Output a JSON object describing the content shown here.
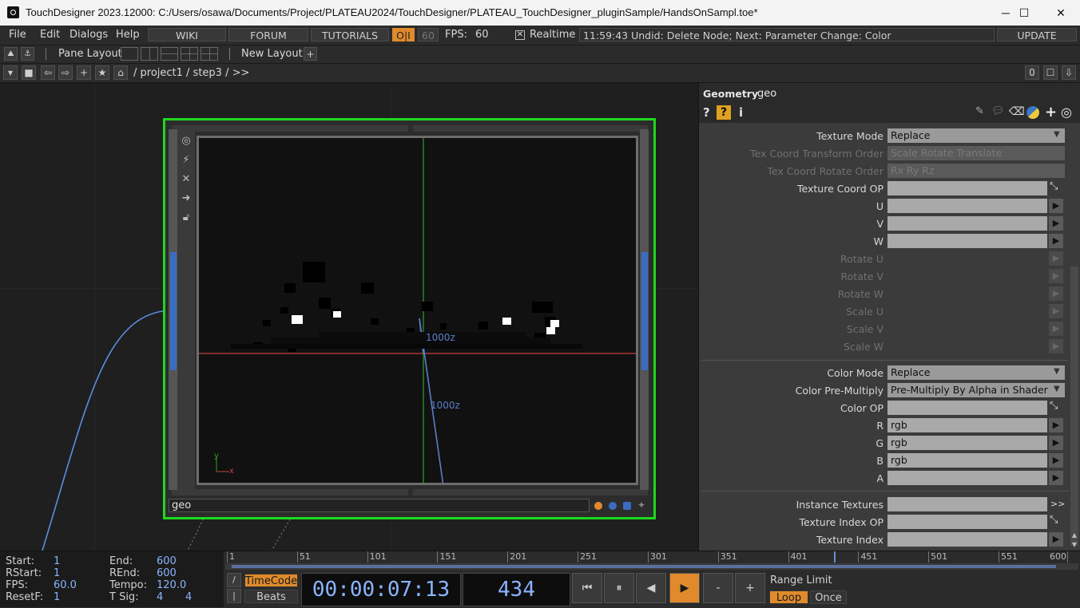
{
  "titlebar": {
    "title": "TouchDesigner 2023.12000: C:/Users/osawa/Documents/Project/PLATEAU2024/TouchDesigner/PLATEAU_TouchDesigner_pluginSample/HandsOnSampl.toe*",
    "minimize": "─",
    "maximize": "☐",
    "close": "✕"
  },
  "menu": {
    "file": "File",
    "edit": "Edit",
    "dialogs": "Dialogs",
    "help": "Help",
    "wiki": "WIKI",
    "forum": "FORUM",
    "tutorials": "TUTORIALS",
    "oi": "O|I",
    "fps_box": "60",
    "fps_label": "FPS:",
    "fps_value": "60",
    "realtime": "Realtime",
    "realtime_check": "✕",
    "status": "11:59:43 Undid: Delete Node; Next: Parameter Change: Color",
    "update": "UPDATE"
  },
  "panerow": {
    "pane_layout": "Pane Layout",
    "new_layout": "New Layout",
    "add": "+"
  },
  "path": {
    "segments": "/ project1 / step3 / >>",
    "counter": "0"
  },
  "network": {
    "node_name": "geo",
    "axis_label_1": "1000z",
    "axis_label_2": "1000z",
    "y_axis": "y",
    "x_axis": "x"
  },
  "param": {
    "op_type": "Geometry",
    "op_name": "geo",
    "rows": {
      "texture_mode": {
        "label": "Texture Mode",
        "value": "Replace"
      },
      "tex_transform_order": {
        "label": "Tex Coord Transform Order",
        "value": "Scale Rotate Translate"
      },
      "tex_rotate_order": {
        "label": "Tex Coord Rotate Order",
        "value": "Rx Ry Rz"
      },
      "texture_coord_op": {
        "label": "Texture Coord OP",
        "value": ""
      },
      "u": {
        "label": "U"
      },
      "v": {
        "label": "V"
      },
      "w": {
        "label": "W"
      },
      "rotate_u": {
        "label": "Rotate U"
      },
      "rotate_v": {
        "label": "Rotate V"
      },
      "rotate_w": {
        "label": "Rotate W"
      },
      "scale_u": {
        "label": "Scale U"
      },
      "scale_v": {
        "label": "Scale V"
      },
      "scale_w": {
        "label": "Scale W"
      },
      "color_mode": {
        "label": "Color Mode",
        "value": "Replace"
      },
      "color_premultiply": {
        "label": "Color Pre-Multiply",
        "value": "Pre-Multiply By Alpha in Shader"
      },
      "color_op": {
        "label": "Color OP",
        "value": ""
      },
      "r": {
        "label": "R",
        "value": "rgb"
      },
      "g": {
        "label": "G",
        "value": "rgb"
      },
      "b": {
        "label": "B",
        "value": "rgb"
      },
      "a": {
        "label": "A",
        "value": ""
      },
      "instance_textures": {
        "label": "Instance Textures",
        "value": "",
        "more": ">>"
      },
      "texture_index_op": {
        "label": "Texture Index OP",
        "value": ""
      },
      "texture_index": {
        "label": "Texture Index",
        "value": ""
      }
    }
  },
  "timeline": {
    "start_label": "Start:",
    "start": "1",
    "end_label": "End:",
    "end": "600",
    "rstart_label": "RStart:",
    "rstart": "1",
    "rend_label": "REnd:",
    "rend": "600",
    "fps_label": "FPS:",
    "fps": "60.0",
    "tempo_label": "Tempo:",
    "tempo": "120.0",
    "resetf_label": "ResetF:",
    "resetf": "1",
    "tsig_label": "T Sig:",
    "tsig_a": "4",
    "tsig_b": "4",
    "ruler": [
      "1",
      "51",
      "101",
      "151",
      "201",
      "251",
      "301",
      "351",
      "401",
      "451",
      "501",
      "551",
      "600"
    ],
    "current_frame": 434,
    "timecode_btn": "TimeCode",
    "beats_btn": "Beats",
    "timecode": "00:00:07:13",
    "frame": "434",
    "range_limit": "Range Limit",
    "loop": "Loop",
    "once": "Once",
    "slash": "/",
    "bar": "|"
  },
  "colors": {
    "node_border": "#1ed81e",
    "accent_orange": "#e08a2c",
    "timecode_blue": "#8ab4ff"
  }
}
